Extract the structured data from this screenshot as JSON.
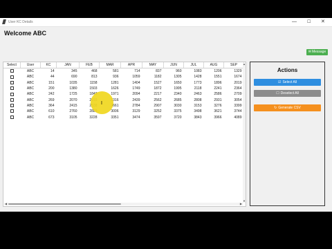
{
  "window": {
    "title": "User KC Details",
    "controls": {
      "minimize": "—",
      "maximize": "☐",
      "close": "✕"
    }
  },
  "header": {
    "welcome": "Welcome ABC",
    "message_button": {
      "icon": "message-icon",
      "label": "Message"
    }
  },
  "table": {
    "columns": [
      "Select",
      "User",
      "KC",
      "JAN",
      "FEB",
      "MAR",
      "APR",
      "MAY",
      "JUN",
      "JUL",
      "AUG",
      "SEP"
    ],
    "rows": [
      [
        "ABC",
        "14",
        "345",
        "468",
        "581",
        "714",
        "837",
        "960",
        "1083",
        "1206",
        "1329"
      ],
      [
        "ABC",
        "44",
        "690",
        "813",
        "936",
        "1059",
        "1182",
        "1305",
        "1428",
        "1551",
        "1674"
      ],
      [
        "ABC",
        "151",
        "1035",
        "1158",
        "1281",
        "1404",
        "1527",
        "1650",
        "1773",
        "1896",
        "2019"
      ],
      [
        "ABC",
        "200",
        "1380",
        "1503",
        "1626",
        "1749",
        "1872",
        "1995",
        "2118",
        "2241",
        "2364"
      ],
      [
        "ABC",
        "242",
        "1725",
        "1848",
        "1971",
        "2094",
        "2217",
        "2340",
        "2463",
        "2586",
        "2709"
      ],
      [
        "ABC",
        "269",
        "2070",
        "2193",
        "2316",
        "2439",
        "2562",
        "2685",
        "2808",
        "2931",
        "3054"
      ],
      [
        "ABC",
        "364",
        "2415",
        "2538",
        "2661",
        "2784",
        "2907",
        "3030",
        "3153",
        "3276",
        "3399"
      ],
      [
        "ABC",
        "610",
        "2760",
        "2883",
        "3006",
        "3129",
        "3252",
        "3375",
        "3498",
        "3621",
        "3744"
      ],
      [
        "ABC",
        "673",
        "3105",
        "3228",
        "3351",
        "3474",
        "3597",
        "3720",
        "3843",
        "3966",
        "4089"
      ]
    ]
  },
  "actions": {
    "title": "Actions",
    "select_all": {
      "icon": "check-square-icon",
      "label": "Select All"
    },
    "deselect_all": {
      "icon": "empty-square-icon",
      "label": "Deselect All"
    },
    "generate": {
      "icon": "sync-icon",
      "label": "Generate CSV"
    }
  }
}
